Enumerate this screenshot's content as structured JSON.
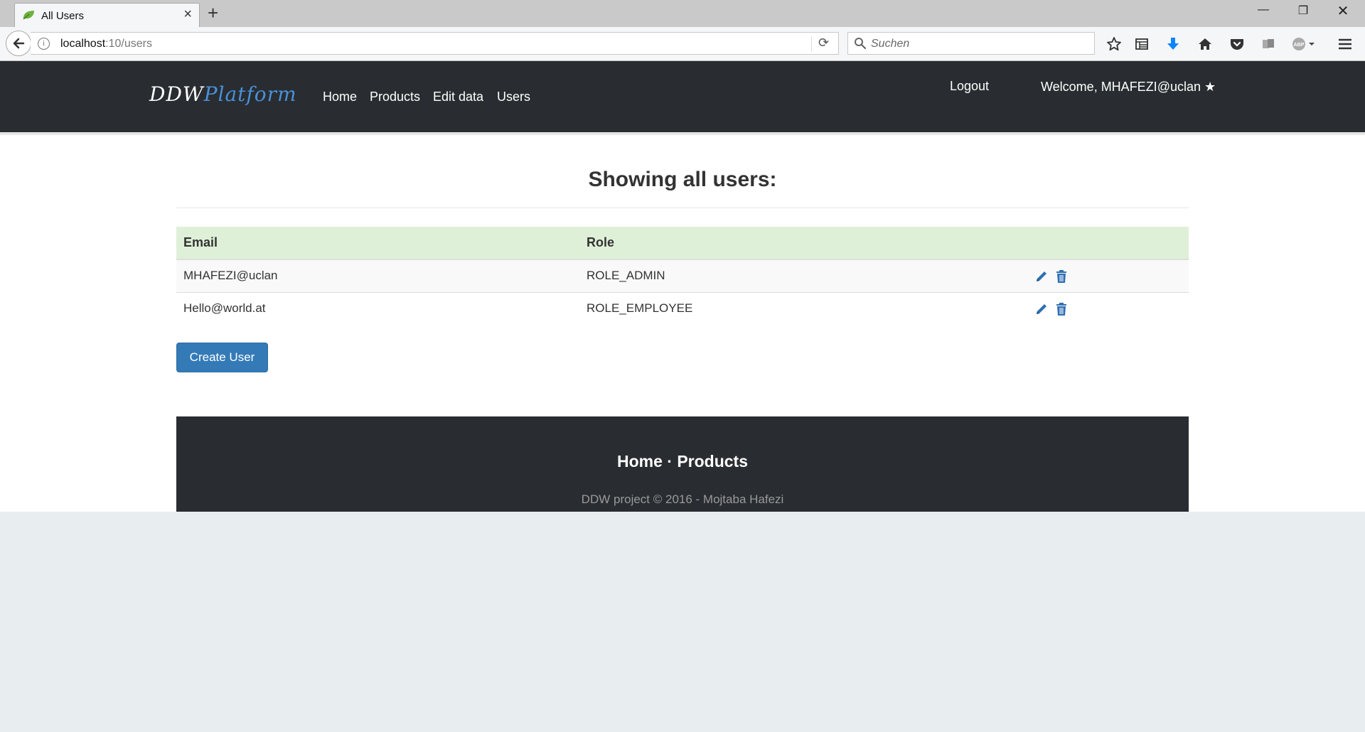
{
  "browser": {
    "tab_title": "All Users",
    "url_host": "localhost",
    "url_rest": ":10/users",
    "search_placeholder": "Suchen"
  },
  "site": {
    "brand_part1": "DDW",
    "brand_part2": "Platform",
    "nav": [
      "Home",
      "Products",
      "Edit data",
      "Users"
    ],
    "logout": "Logout",
    "welcome": "Welcome, MHAFEZI@uclan",
    "welcome_star": "★"
  },
  "main": {
    "heading": "Showing all users:",
    "table": {
      "headers": [
        "Email",
        "Role"
      ],
      "rows": [
        {
          "email": "MHAFEZI@uclan",
          "role": "ROLE_ADMIN"
        },
        {
          "email": "Hello@world.at",
          "role": "ROLE_EMPLOYEE"
        }
      ]
    },
    "create_button": "Create User"
  },
  "footer": {
    "link_home": "Home",
    "separator": "·",
    "link_products": "Products",
    "copyright": "DDW project © 2016 - Mojtaba Hafezi"
  },
  "colors": {
    "nav_bg": "#292d31",
    "table_header_bg": "#dff0d8",
    "primary": "#337ab7",
    "icon_blue": "#2f6fb3"
  }
}
